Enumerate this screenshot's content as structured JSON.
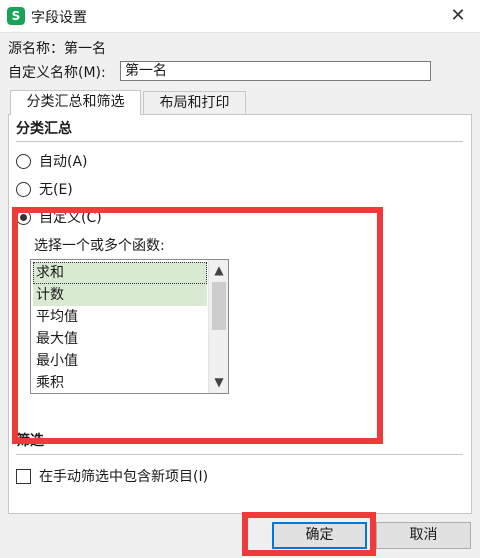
{
  "window": {
    "icon_letter": "S",
    "title": "字段设置",
    "close_glyph": "✕"
  },
  "fields": {
    "source_label": "源名称：第一名",
    "custom_label": "自定义名称(M):",
    "custom_value": "第一名"
  },
  "tabs": [
    {
      "label": "分类汇总和筛选",
      "active": true
    },
    {
      "label": "布局和打印",
      "active": false
    }
  ],
  "subtotal": {
    "title": "分类汇总",
    "options": [
      {
        "label": "自动(A)",
        "checked": false
      },
      {
        "label": "无(E)",
        "checked": false
      },
      {
        "label": "自定义(C)",
        "checked": true
      }
    ],
    "function_prompt": "选择一个或多个函数:",
    "functions": [
      {
        "label": "求和",
        "selected": true,
        "focused": true
      },
      {
        "label": "计数",
        "selected": true,
        "focused": false
      },
      {
        "label": "平均值",
        "selected": false,
        "focused": false
      },
      {
        "label": "最大值",
        "selected": false,
        "focused": false
      },
      {
        "label": "最小值",
        "selected": false,
        "focused": false
      },
      {
        "label": "乘积",
        "selected": false,
        "focused": false
      }
    ]
  },
  "filter": {
    "title": "筛选",
    "include_new_label": "在手动筛选中包含新项目(I)",
    "include_new_checked": false
  },
  "buttons": {
    "ok": "确定",
    "cancel": "取消"
  },
  "colors": {
    "highlight": "#ef3a3a",
    "selected_row": "#d9ead3",
    "app_icon": "#19a35a"
  }
}
